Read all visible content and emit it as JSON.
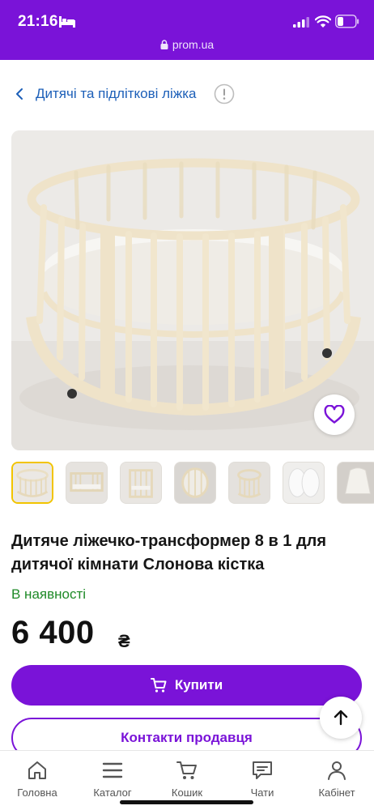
{
  "status_bar": {
    "time": "21:16"
  },
  "url_bar": {
    "domain": "prom.ua"
  },
  "breadcrumb": {
    "label": "Дитячі та підліткові ліжка"
  },
  "product": {
    "title": "Дитяче ліжечко-трансформер 8 в 1 для дитячої кімнати Слонова кістка",
    "availability": "В наявності",
    "price": "6 400",
    "currency": "₴",
    "thumbnail_count": 7,
    "selected_thumbnail": 1
  },
  "actions": {
    "buy_label": "Купити",
    "contact_label": "Контакти продавця"
  },
  "bottom_nav": {
    "items": [
      {
        "label": "Головна",
        "icon": "home-icon"
      },
      {
        "label": "Каталог",
        "icon": "menu-icon"
      },
      {
        "label": "Кошик",
        "icon": "cart-icon"
      },
      {
        "label": "Чати",
        "icon": "chat-icon"
      },
      {
        "label": "Кабінет",
        "icon": "user-icon"
      }
    ]
  },
  "colors": {
    "brand": "#7a13d8",
    "link": "#1c5fb8",
    "in_stock": "#1e8a27",
    "selected_thumb_border": "#f2c400"
  }
}
